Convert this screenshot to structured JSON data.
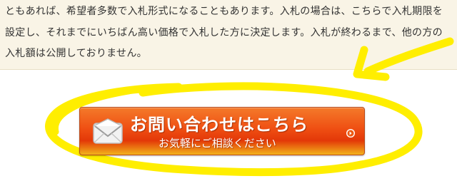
{
  "notice": {
    "text": "ともあれば、希望者多数で入札形式になることもあります。入札の場合は、こちらで入札期限を設定し、それまでにいちばん高い価格で入札した方に決定します。入札が終わるまで、他の方の入札額は公開しておりません。"
  },
  "cta": {
    "title": "お問い合わせはこちら",
    "subtitle": "お気軽にご相談ください"
  },
  "icons": {
    "mail": "mail-icon",
    "arrow": "chevron-right-circle-icon"
  },
  "colors": {
    "background": "#ffffff",
    "notice_background": "#f9f4e6",
    "button_top": "#f47a2a",
    "button_mid": "#e33808",
    "button_bottom": "#f2b21b",
    "annotation": "#ffee00"
  }
}
